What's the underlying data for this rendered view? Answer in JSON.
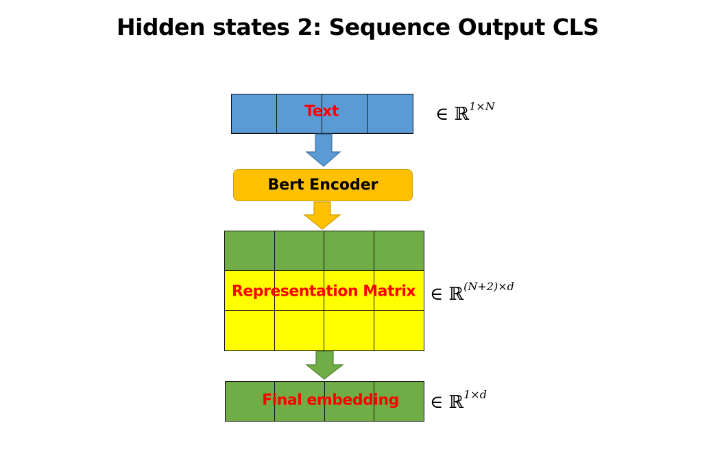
{
  "title": "Hidden states 2: Sequence Output CLS",
  "input": {
    "label": "Text",
    "color": "#5B9BD5",
    "dim_prefix": "∈ ℝ",
    "dim_sup": "1×N"
  },
  "encoder": {
    "label": "Bert Encoder",
    "color": "#FFC000"
  },
  "matrix": {
    "label": "Representation Matrix",
    "top_row_color": "#70AD47",
    "body_color": "#FFFF00",
    "dim_prefix": "∈ ℝ",
    "dim_sup": "(N+2)×d"
  },
  "output": {
    "label": "Final embedding",
    "color": "#70AD47",
    "dim_prefix": "∈ ℝ",
    "dim_sup": "1×d"
  },
  "label_color": "#FF0000"
}
